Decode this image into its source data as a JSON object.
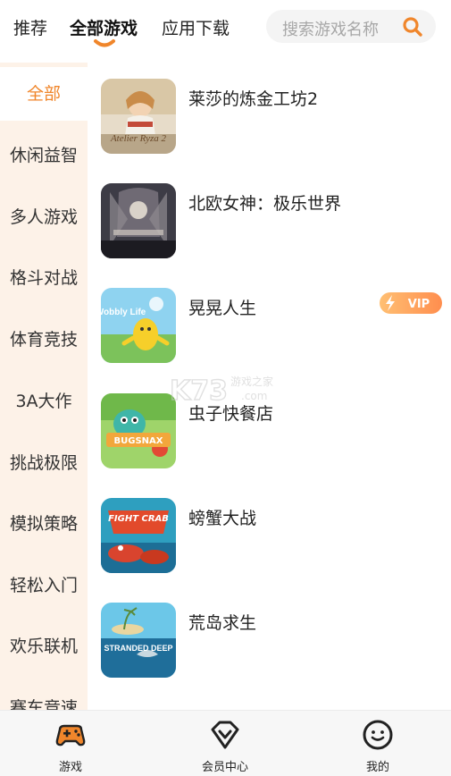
{
  "top_tabs": [
    {
      "label": "推荐",
      "active": false
    },
    {
      "label": "全部游戏",
      "active": true
    },
    {
      "label": "应用下载",
      "active": false
    }
  ],
  "search": {
    "placeholder": "搜索游戏名称",
    "icon": "search-icon"
  },
  "sidebar": {
    "items": [
      {
        "label": "全部",
        "active": true
      },
      {
        "label": "休闲益智"
      },
      {
        "label": "多人游戏"
      },
      {
        "label": "格斗对战"
      },
      {
        "label": "体育竞技"
      },
      {
        "label": "3A大作"
      },
      {
        "label": "挑战极限"
      },
      {
        "label": "模拟策略"
      },
      {
        "label": "轻松入门"
      },
      {
        "label": "欢乐联机"
      },
      {
        "label": "赛车竞速"
      }
    ]
  },
  "games": [
    {
      "name": "莱莎的炼金工坊2",
      "cover_title": "Atelier Ryza 2",
      "vip": false
    },
    {
      "name": "北欧女神：极乐世界",
      "cover_title": "",
      "vip": false
    },
    {
      "name": "晃晃人生",
      "cover_title": "Wobbly Life",
      "vip": true
    },
    {
      "name": "虫子快餐店",
      "cover_title": "BUGSNAX",
      "vip": false
    },
    {
      "name": "螃蟹大战",
      "cover_title": "FIGHT CRAB",
      "vip": false
    },
    {
      "name": "荒岛求生",
      "cover_title": "STRANDED DEEP",
      "vip": false
    }
  ],
  "vip_badge": {
    "label": "VIP"
  },
  "watermark": {
    "logo": "K73",
    "subtitle": "游戏之家",
    "domain": ".com"
  },
  "bottom_nav": [
    {
      "label": "游戏",
      "icon": "gamepad-icon"
    },
    {
      "label": "会员中心",
      "icon": "diamond-icon"
    },
    {
      "label": "我的",
      "icon": "smiley-icon"
    }
  ],
  "colors": {
    "accent": "#f0862b",
    "sidebar_bg": "#fdf2e8",
    "search_bg": "#f4f4f4",
    "vip_gradient": [
      "#ffb45a",
      "#ff7a2f"
    ]
  }
}
